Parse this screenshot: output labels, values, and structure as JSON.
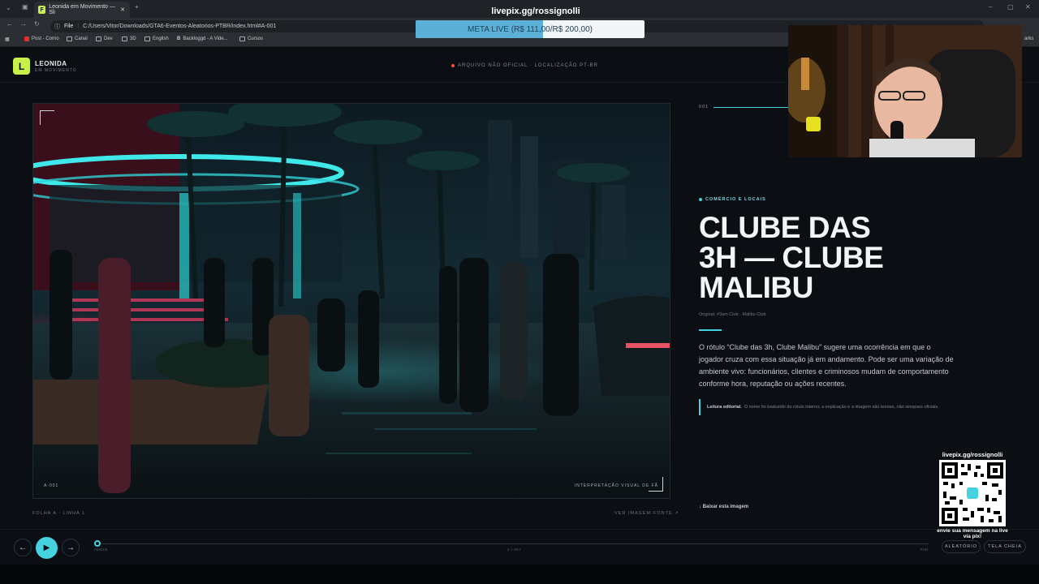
{
  "browser": {
    "tab_title": "Leonida em Movimento — Sli",
    "tab_favicon": "F",
    "url_scheme": "File",
    "url": "C:/Users/Vitor/Downloads/GTA6-Eventos-Aleatorios-PTBR/index.html#A-001",
    "bookmarks": [
      "Post - Corno",
      "Canal",
      "Dev",
      "3D",
      "English",
      "Backloggd - A Vide...",
      "Cursos"
    ],
    "bookmarks_overflow": "arks"
  },
  "header": {
    "logo_letter": "L",
    "brand": "LEONIDA",
    "brand_sub": "EM MOVIMENTO",
    "archive_label": "ARQUIVO NÃO OFICIAL · LOCALIZAÇÃO PT-BR"
  },
  "scene": {
    "tag_left": "A-001",
    "tag_right": "INTERPRETAÇÃO VISUAL DE FÃ",
    "footer_left": "FOLHA A · LINHA 1",
    "footer_right": "VER IMAGEM-FONTE ↗"
  },
  "entry": {
    "number": "001",
    "category": "COMÉRCIO E LOCAIS",
    "title_lines": [
      "CLUBE DAS",
      "3H — CLUBE",
      "MALIBU"
    ],
    "original": "Original: #3am Club - Malibu Club",
    "body": "O rótulo “Clube das 3h, Clube Malibu” sugere uma ocorrência em que o jogador cruza com essa situação já em andamento. Pode ser uma variação de ambiente vivo: funcionários, clientes e criminosos mudam de comportamento conforme hora, reputação ou ações recentes.",
    "note_label": "Leitura editorial.",
    "note_text": "O nome foi traduzido do rótulo interno; a explicação e a imagem são teorias, não sinopses oficiais.",
    "download": "↓ Baixar esta imagem"
  },
  "controls": {
    "prev": "←",
    "play": "▶",
    "next": "→",
    "start_label": "INÍCIO",
    "counter": "1 / 007",
    "end_label": "FIM",
    "random": "ALEATÓRIO",
    "fullscreen": "TELA CHEIA",
    "progress": 0
  },
  "overlay": {
    "stream_url": "livepix.gg/rossignolli",
    "meta_text": "META LIVE (R$ 111,00/R$ 200,00)",
    "meta_fraction": 0.555,
    "qr_title": "livepix.gg/rossignolli",
    "qr_caption": "envie sua mensagem na live via pix!"
  },
  "colors": {
    "accent": "#45d3df",
    "lime": "#c7f04a",
    "live_dot": "#ff4d3a"
  }
}
